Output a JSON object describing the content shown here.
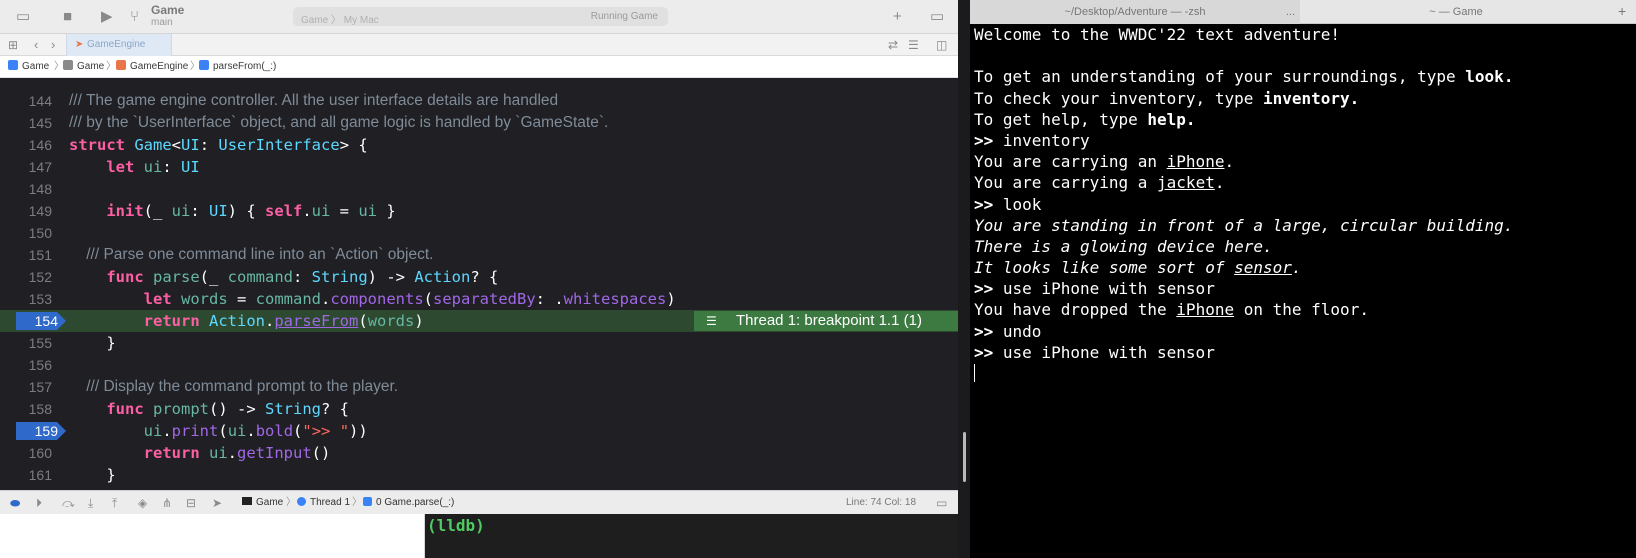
{
  "xcode": {
    "toolbar": {
      "scheme_name": "Game",
      "scheme_branch": "main",
      "destination": "Game 〉 My Mac",
      "activity_status": "Running Game"
    },
    "tab": {
      "label": "GameEngine"
    },
    "jumpbar": [
      "Game",
      "Game",
      "GameEngine",
      "parseFrom(_:)"
    ],
    "breakpoint_badge": "Thread 1: breakpoint 1.1 (1)",
    "lines": [
      {
        "n": "144",
        "text": "/// The game engine controller. All the user interface details are handled"
      },
      {
        "n": "145",
        "text": "/// by the `UserInterface` object, and all game logic is handled by `GameState`."
      },
      {
        "n": "146",
        "text": "struct Game<UI: UserInterface> {"
      },
      {
        "n": "147",
        "text": "    let ui: UI"
      },
      {
        "n": "148",
        "text": ""
      },
      {
        "n": "149",
        "text": "    init(_ ui: UI) { self.ui = ui }"
      },
      {
        "n": "150",
        "text": ""
      },
      {
        "n": "151",
        "text": "    /// Parse one command line into an `Action` object."
      },
      {
        "n": "152",
        "text": "    func parse(_ command: String) -> Action? {"
      },
      {
        "n": "153",
        "text": "        let words = command.components(separatedBy: .whitespaces)"
      },
      {
        "n": "154",
        "text": "        return Action.parseFrom(words)"
      },
      {
        "n": "155",
        "text": "    }"
      },
      {
        "n": "156",
        "text": ""
      },
      {
        "n": "157",
        "text": "    /// Display the command prompt to the player."
      },
      {
        "n": "158",
        "text": "    func prompt() -> String? {"
      },
      {
        "n": "159",
        "text": "        ui.print(ui.bold(\">> \"))"
      },
      {
        "n": "160",
        "text": "        return ui.getInput()"
      },
      {
        "n": "161",
        "text": "    }"
      }
    ],
    "debugbar": {
      "crumbs": [
        "Game",
        "Thread 1",
        "0 Game.parse(_:)"
      ],
      "position": "Line: 74  Col: 18"
    },
    "console_prompt": "(lldb)"
  },
  "terminal": {
    "tabs": [
      "~/Desktop/Adventure — -zsh",
      "~ — Game"
    ],
    "tab_overflow": "...",
    "lines": [
      "Welcome to the WWDC'22 text adventure!",
      "",
      "To get an understanding of your surroundings, type look.",
      "To check your inventory, type inventory.",
      "To get help, type help.",
      ">> inventory",
      "You are carrying an iPhone.",
      "You are carrying a jacket.",
      ">> look",
      "You are standing in front of a large, circular building.",
      "There is a glowing device here.",
      "It looks like some sort of sensor.",
      ">> use iPhone with sensor",
      "You have dropped the iPhone on the floor.",
      ">> undo",
      ">> use iPhone with sensor"
    ]
  },
  "colors": {
    "editor_bg": "#1f1f24",
    "keyword": "#fc5fa3",
    "type": "#5dd8ff",
    "comment": "#7f8c98",
    "breakpoint": "#2f69c9",
    "highlight_line": "#2d4a31",
    "console_text": "#4fca62"
  }
}
